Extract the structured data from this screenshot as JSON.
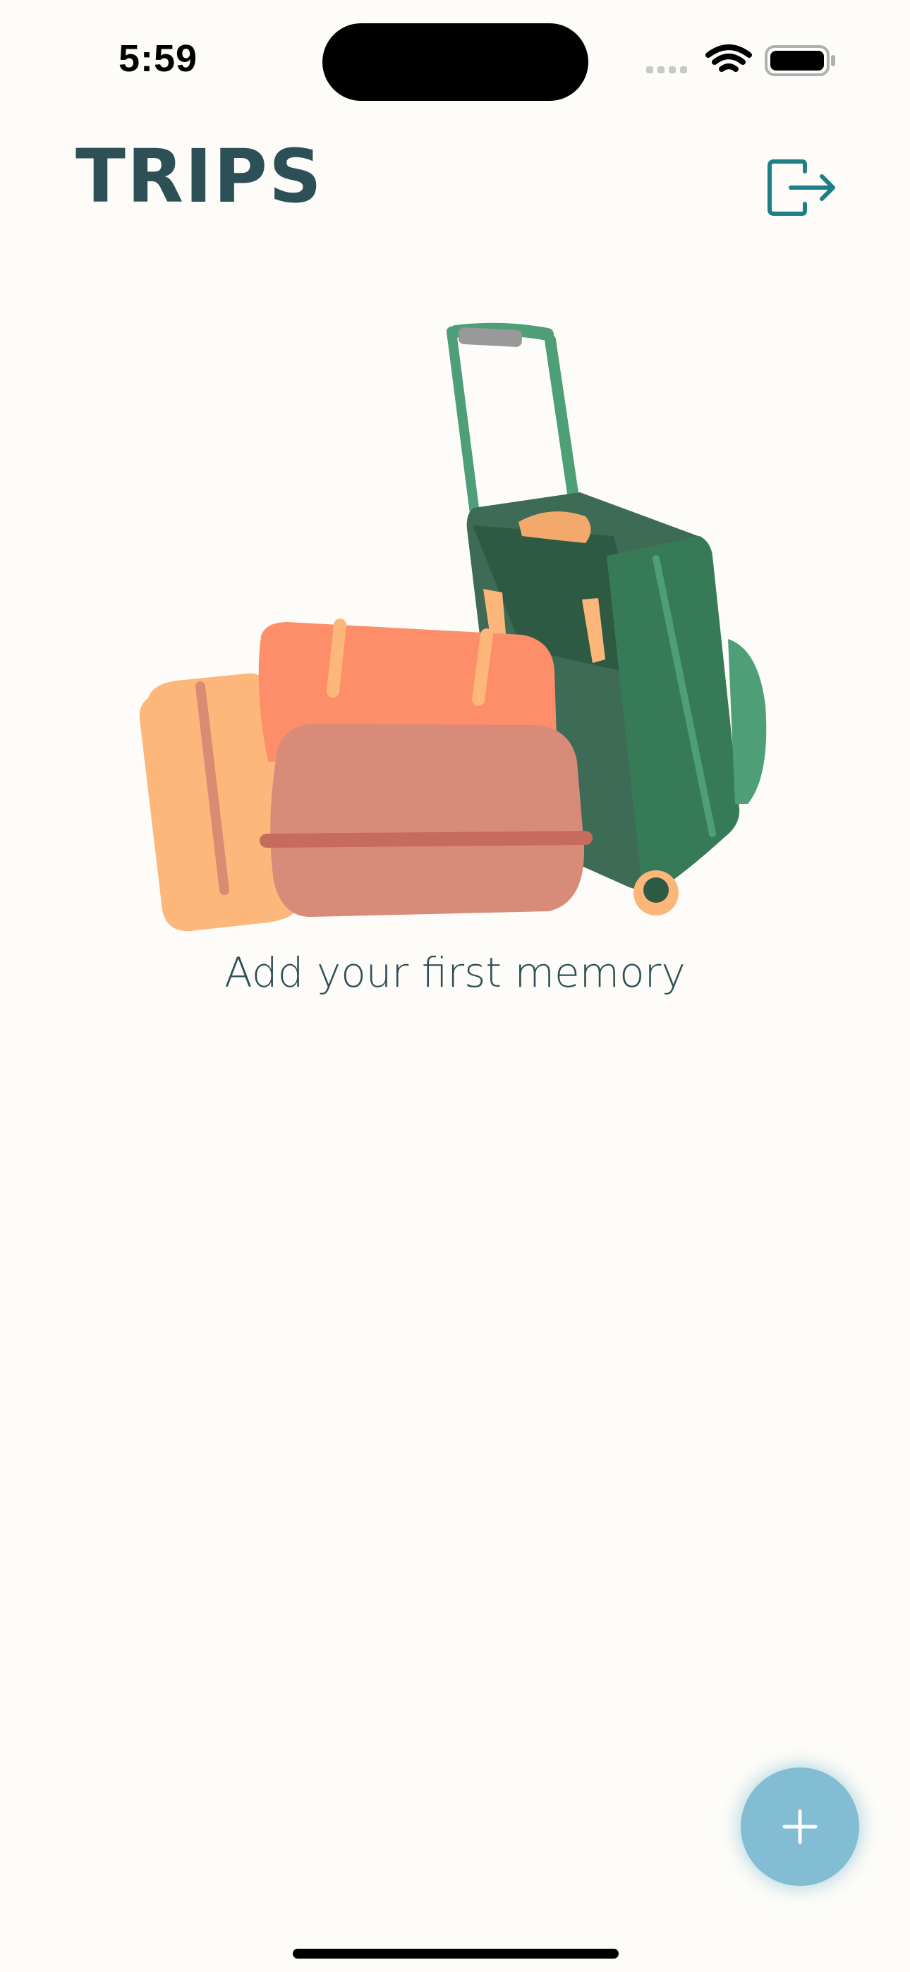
{
  "status_bar": {
    "time": "5:59",
    "icons": [
      "signal-icon",
      "wifi-icon",
      "battery-icon"
    ]
  },
  "header": {
    "title": "TRIPS",
    "logout_icon": "logout-icon"
  },
  "empty_state": {
    "illustration": "luggage-illustration",
    "message": "Add your first memory"
  },
  "fab": {
    "icon": "plus-icon"
  },
  "colors": {
    "background": "#fdfcf8",
    "title": "#2d5057",
    "accent_teal": "#1f7f86",
    "fab": "#82bdd3"
  }
}
